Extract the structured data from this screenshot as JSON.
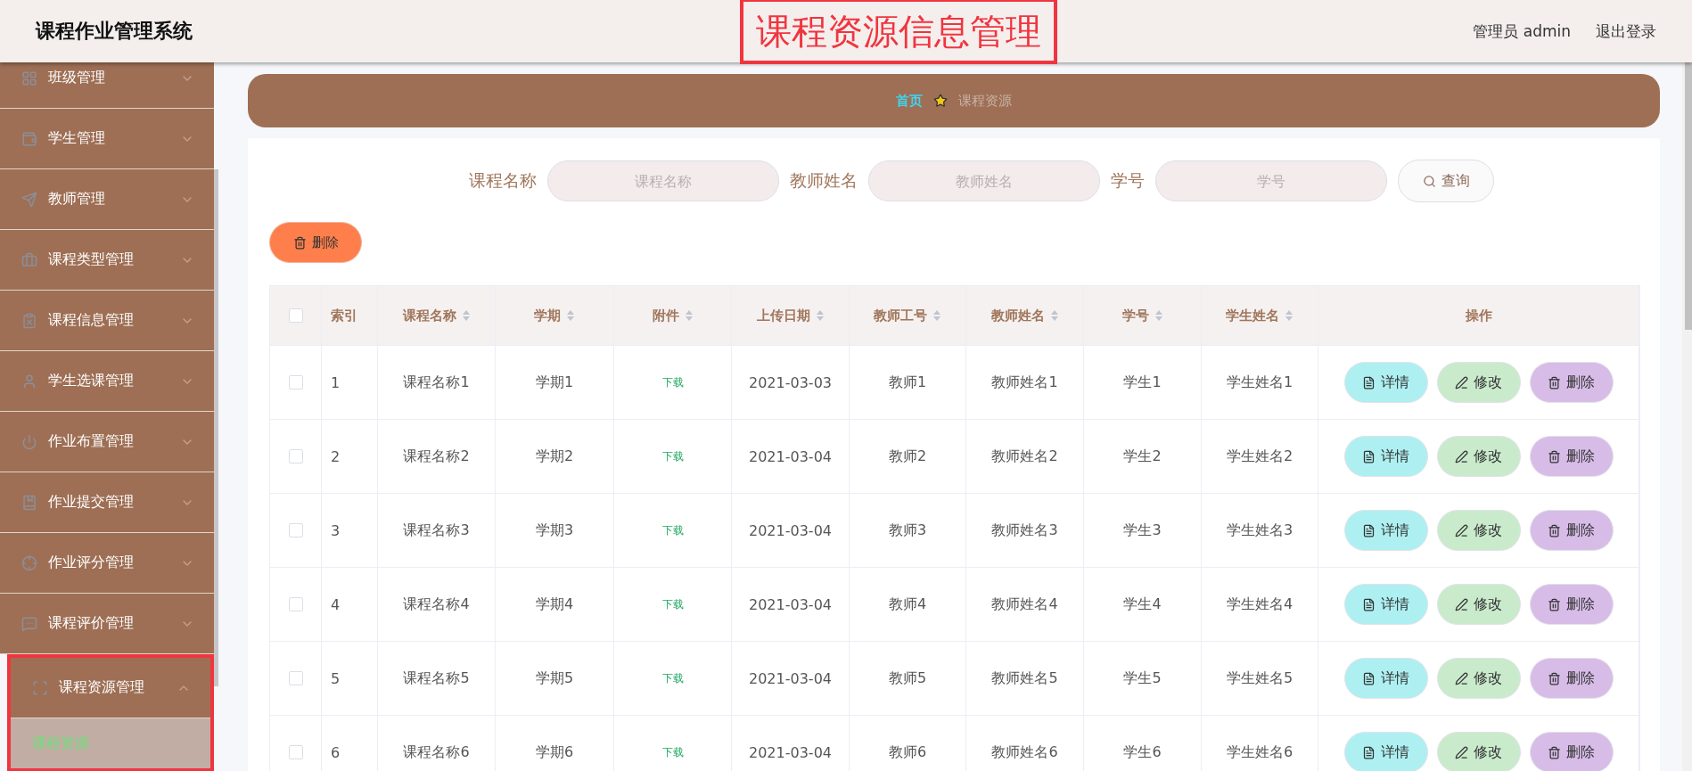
{
  "header": {
    "system_title": "课程作业管理系统",
    "page_title": "课程资源信息管理",
    "user": "管理员 admin",
    "logout": "退出登录"
  },
  "sidebar": {
    "items": [
      {
        "label": "班级管理",
        "expanded": false
      },
      {
        "label": "学生管理",
        "expanded": false
      },
      {
        "label": "教师管理",
        "expanded": false
      },
      {
        "label": "课程类型管理",
        "expanded": false
      },
      {
        "label": "课程信息管理",
        "expanded": false
      },
      {
        "label": "学生选课管理",
        "expanded": false
      },
      {
        "label": "作业布置管理",
        "expanded": false
      },
      {
        "label": "作业提交管理",
        "expanded": false
      },
      {
        "label": "作业评分管理",
        "expanded": false
      },
      {
        "label": "课程评价管理",
        "expanded": false
      },
      {
        "label": "课程资源管理",
        "expanded": true,
        "children": [
          {
            "label": "课程资源",
            "selected": true
          }
        ]
      }
    ]
  },
  "breadcrumb": [
    {
      "label": "首页"
    },
    {
      "label": "课程资源"
    }
  ],
  "search": {
    "fields": [
      {
        "label": "课程名称",
        "placeholder": "课程名称"
      },
      {
        "label": "教师姓名",
        "placeholder": "教师姓名"
      },
      {
        "label": "学号",
        "placeholder": "学号"
      }
    ],
    "button": "查询"
  },
  "delete_button": "删除",
  "table": {
    "all_checked": false,
    "columns": [
      {
        "label": "索引",
        "sortable": false
      },
      {
        "label": "课程名称",
        "sortable": true
      },
      {
        "label": "学期",
        "sortable": true
      },
      {
        "label": "附件",
        "sortable": true
      },
      {
        "label": "上传日期",
        "sortable": true
      },
      {
        "label": "教师工号",
        "sortable": true
      },
      {
        "label": "教师姓名",
        "sortable": true
      },
      {
        "label": "学号",
        "sortable": true
      },
      {
        "label": "学生姓名",
        "sortable": true
      },
      {
        "label": "操作",
        "sortable": false
      }
    ],
    "rows": [
      {
        "checked": false,
        "cells": [
          "1",
          "课程名称1",
          "学期1",
          "下载",
          "2021-03-03",
          "教师1",
          "教师姓名1",
          "学生1",
          "学生姓名1"
        ],
        "actions": [
          "详情",
          "修改",
          "删除"
        ]
      },
      {
        "checked": false,
        "cells": [
          "2",
          "课程名称2",
          "学期2",
          "下载",
          "2021-03-04",
          "教师2",
          "教师姓名2",
          "学生2",
          "学生姓名2"
        ],
        "actions": [
          "详情",
          "修改",
          "删除"
        ]
      },
      {
        "checked": false,
        "cells": [
          "3",
          "课程名称3",
          "学期3",
          "下载",
          "2021-03-04",
          "教师3",
          "教师姓名3",
          "学生3",
          "学生姓名3"
        ],
        "actions": [
          "详情",
          "修改",
          "删除"
        ]
      },
      {
        "checked": false,
        "cells": [
          "4",
          "课程名称4",
          "学期4",
          "下载",
          "2021-03-04",
          "教师4",
          "教师姓名4",
          "学生4",
          "学生姓名4"
        ],
        "actions": [
          "详情",
          "修改",
          "删除"
        ]
      },
      {
        "checked": false,
        "cells": [
          "5",
          "课程名称5",
          "学期5",
          "下载",
          "2021-03-04",
          "教师5",
          "教师姓名5",
          "学生5",
          "学生姓名5"
        ],
        "actions": [
          "详情",
          "修改",
          "删除"
        ]
      },
      {
        "checked": false,
        "cells": [
          "6",
          "课程名称6",
          "学期6",
          "下载",
          "2021-03-04",
          "教师6",
          "教师姓名6",
          "学生6",
          "学生姓名6"
        ],
        "actions": [
          "详情",
          "修改",
          "删除"
        ]
      }
    ]
  }
}
